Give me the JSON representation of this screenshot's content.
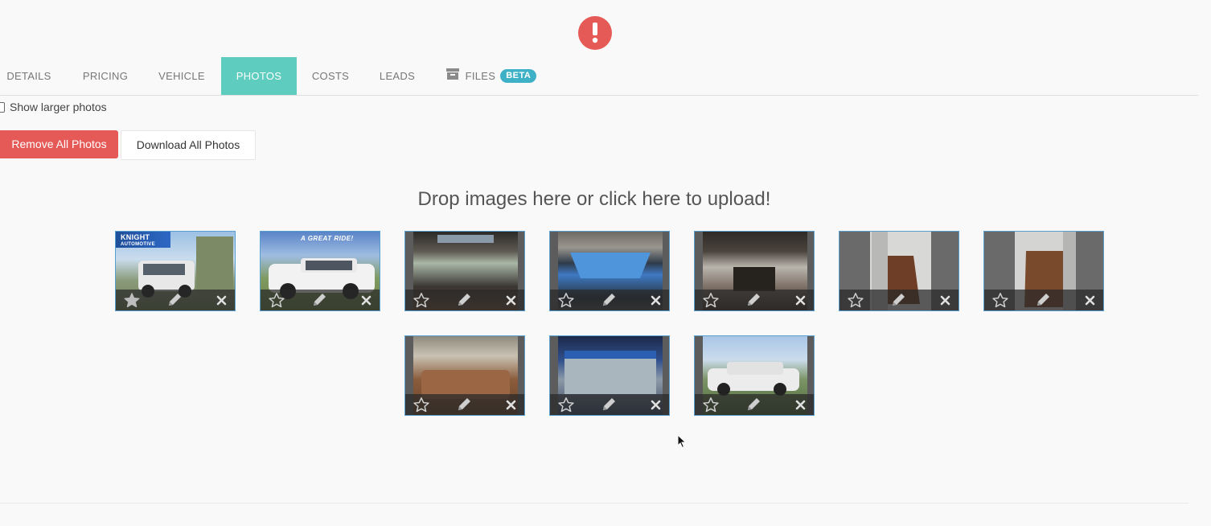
{
  "tabs": [
    {
      "label": "DETAILS",
      "active": false
    },
    {
      "label": "PRICING",
      "active": false
    },
    {
      "label": "VEHICLE",
      "active": false
    },
    {
      "label": "PHOTOS",
      "active": true
    },
    {
      "label": "COSTS",
      "active": false
    },
    {
      "label": "LEADS",
      "active": false
    },
    {
      "label": "FILES",
      "active": false,
      "badge": "BETA",
      "icon": "archive-icon"
    }
  ],
  "options": {
    "show_larger_label": "Show larger photos",
    "show_larger_checked": false
  },
  "actions": {
    "remove_all_label": "Remove All Photos",
    "download_all_label": "Download All Photos"
  },
  "dropzone": {
    "text": "Drop images here or click here to upload!"
  },
  "photos": [
    {
      "featured": true,
      "caption": "KNIGHT",
      "caption_sub": "AUTOMOTIVE"
    },
    {
      "featured": false,
      "caption": "A GREAT RIDE!"
    },
    {
      "featured": false
    },
    {
      "featured": false
    },
    {
      "featured": false
    },
    {
      "featured": false
    },
    {
      "featured": false
    },
    {
      "featured": false
    },
    {
      "featured": false
    },
    {
      "featured": false
    }
  ],
  "colors": {
    "accent": "#5ecdbf",
    "danger": "#e55a57",
    "badge": "#3fb1c7",
    "thumb_border": "#5a9fd0"
  },
  "icons": {
    "alert": "exclamation-circle-icon",
    "star": "star-icon",
    "edit": "pencil-icon",
    "delete": "close-icon"
  }
}
